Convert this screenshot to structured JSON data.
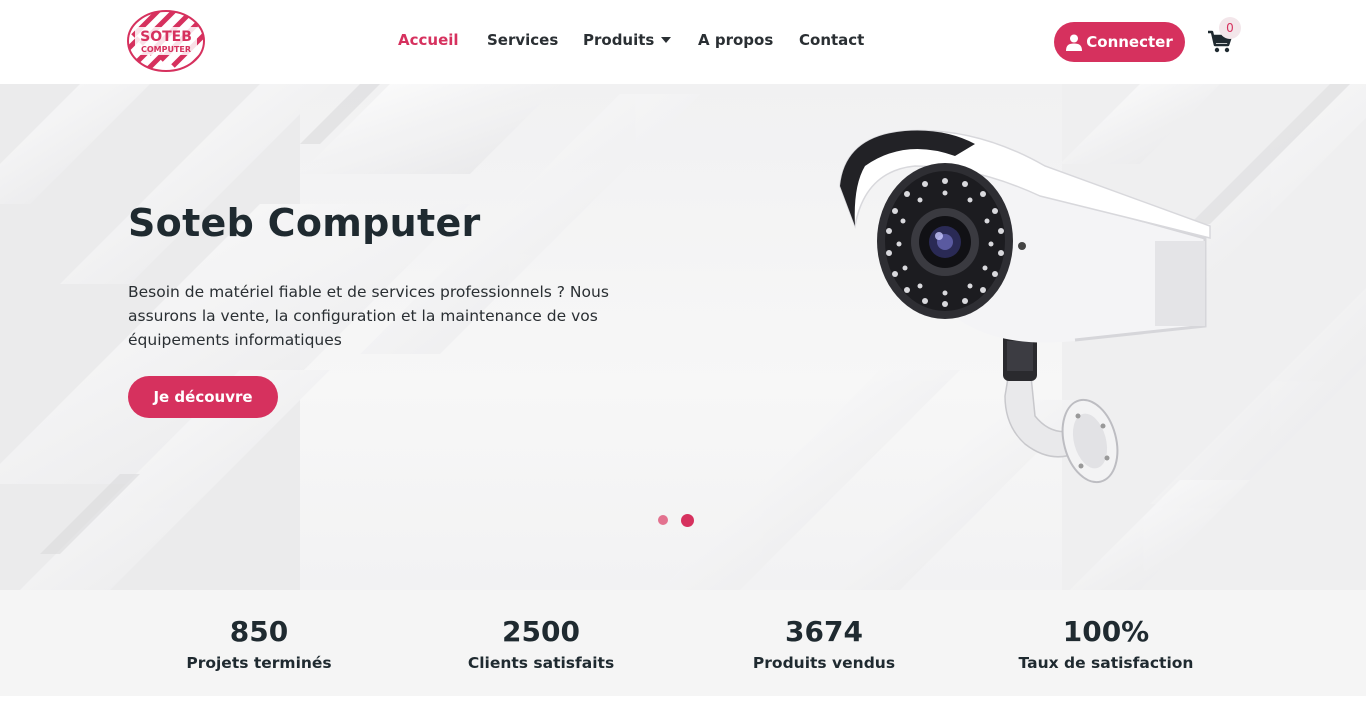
{
  "brand": {
    "logo_top": "SOTEB",
    "logo_bottom": "COMPUTER",
    "accent_color": "#d6315e"
  },
  "nav": {
    "items": [
      {
        "label": "Accueil",
        "active": true
      },
      {
        "label": "Services"
      },
      {
        "label": "Produits",
        "has_dropdown": true
      },
      {
        "label": "A propos"
      },
      {
        "label": "Contact"
      }
    ]
  },
  "header": {
    "connect_label": "Connecter",
    "user_icon": "user-icon",
    "cart_icon": "cart-icon",
    "cart_count": "0"
  },
  "hero": {
    "title": "Soteb Computer",
    "text": "Besoin de matériel fiable et de services professionnels ? Nous assurons la vente, la configuration et la maintenance de vos équipements informatiques",
    "button_label": "Je découvre",
    "image": "security-camera",
    "slides_count": 2,
    "active_slide": 2
  },
  "stats": [
    {
      "value": "850",
      "label": "Projets terminés"
    },
    {
      "value": "2500",
      "label": "Clients satisfaits"
    },
    {
      "value": "3674",
      "label": "Produits vendus"
    },
    {
      "value": "100%",
      "label": "Taux de satisfaction"
    }
  ]
}
